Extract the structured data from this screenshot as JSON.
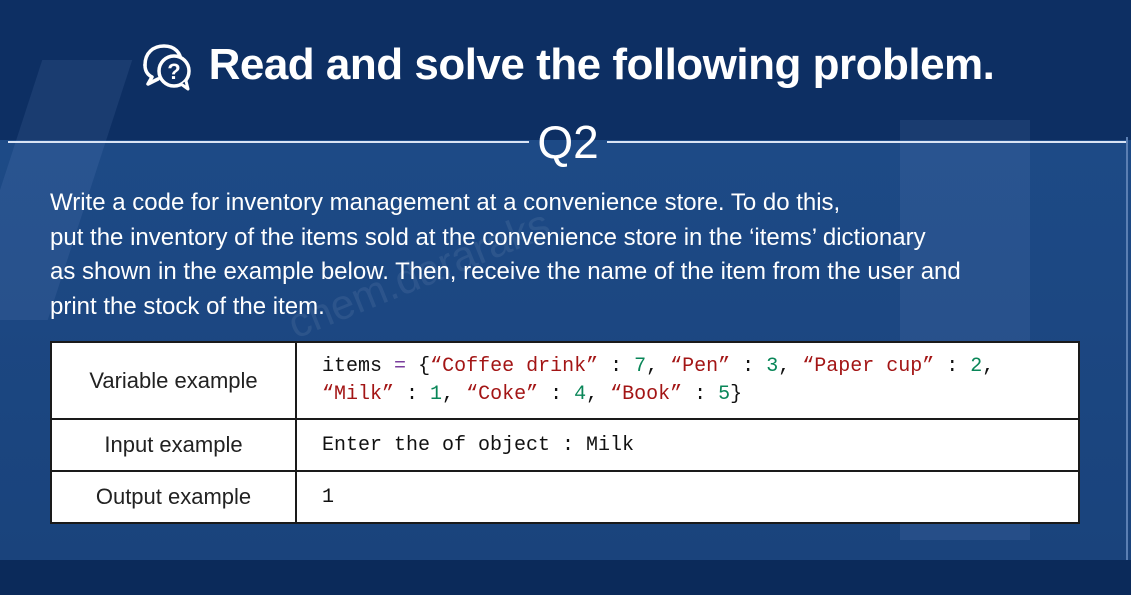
{
  "header": {
    "title": "Read and solve the following problem.",
    "icon": "question-chat-icon"
  },
  "question": {
    "label": "Q2"
  },
  "problem": {
    "lines": [
      "Write a code for inventory management at a convenience store. To do this,",
      "put the inventory of the items sold at the convenience store in the ‘items’ dictionary",
      "as shown in the example below. Then, receive the name of the item from the user and",
      "print the stock of the item."
    ]
  },
  "table": {
    "rows": [
      {
        "label": "Variable example",
        "code": {
          "var": "items",
          "op": "=",
          "open": "{",
          "entries": [
            {
              "key": "“Coffee drink”",
              "value": "7"
            },
            {
              "key": "“Pen”",
              "value": "3"
            },
            {
              "key": "“Paper cup”",
              "value": "2"
            },
            {
              "key": "“Milk”",
              "value": "1"
            },
            {
              "key": "“Coke”",
              "value": "4"
            },
            {
              "key": "“Book”",
              "value": "5"
            }
          ],
          "close": "}"
        }
      },
      {
        "label": "Input example",
        "value": "Enter the of object : Milk"
      },
      {
        "label": "Output example",
        "value": "1"
      }
    ]
  },
  "colors": {
    "background": "#0d2f63",
    "panel": "#1d4a86",
    "string": "#a31515",
    "number": "#098658",
    "operator": "#7a3e9d"
  },
  "watermark": "chem.dararaks"
}
